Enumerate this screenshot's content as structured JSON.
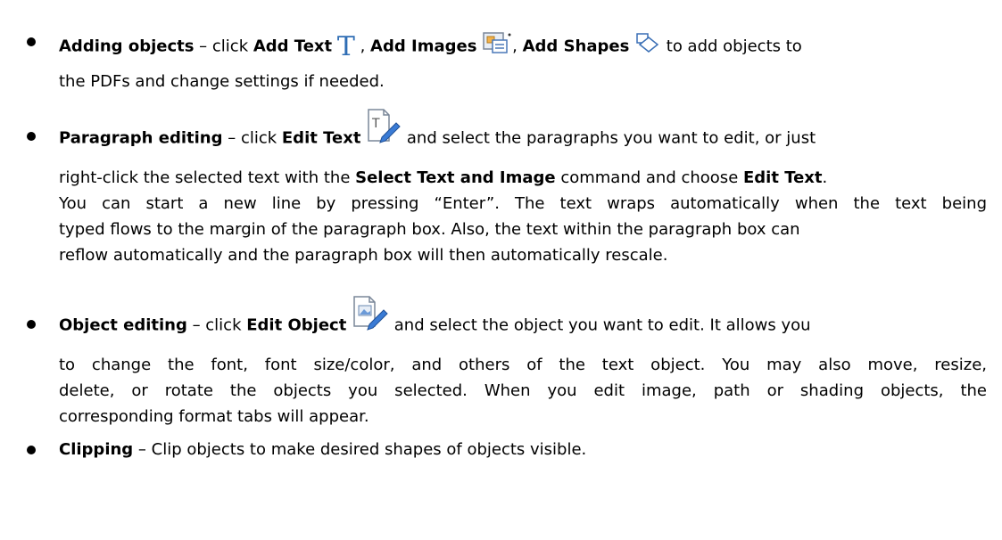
{
  "items": [
    {
      "title": "Adding objects",
      "lines": {
        "l1_dash": " – click ",
        "l1_b1": "Add Text",
        "l1_comma1": " , ",
        "l1_b2": "Add Images",
        "l1_comma2": ", ",
        "l1_b3": "Add Shapes",
        "l1_tail": " to add objects to",
        "l2": "the PDFs and change settings if needed."
      },
      "icons": [
        "text-icon",
        "add-images-icon",
        "add-shapes-icon"
      ]
    },
    {
      "title": "Paragraph editing",
      "lines": {
        "l1_dash": " – click ",
        "l1_b1": "Edit Text",
        "l1_tail": " and select the paragraphs you want to edit, or just",
        "l2_a": "right-click the selected text with the ",
        "l2_b": "Select Text and Image",
        "l2_c": " command and choose ",
        "l2_d": "Edit Text",
        "l2_e": ".",
        "l3": "You can start a new line by pressing “Enter”. The text wraps automatically when the text being",
        "l4": "typed flows to the margin of the paragraph box. Also, the text within the paragraph box can",
        "l5": "reflow automatically and the paragraph box will then automatically rescale."
      },
      "icons": [
        "edit-text-icon"
      ]
    },
    {
      "title": "Object editing",
      "lines": {
        "l1_dash": " – click ",
        "l1_b1": "Edit Object",
        "l1_tail": " and select the object you want to edit. It allows you",
        "l2": "to change the font, font size/color, and others of the text object. You may also move, resize,",
        "l3": "delete, or rotate the objects you selected. When you edit image, path or shading objects, the",
        "l4": "corresponding format tabs will appear."
      },
      "icons": [
        "edit-object-icon"
      ]
    },
    {
      "title": "Clipping",
      "lines": {
        "l1_tail": " – Clip objects to make desired shapes of objects visible."
      }
    }
  ],
  "colors": {
    "icon_blue": "#2e6db4",
    "pencil_blue": "#3a7bd5",
    "text": "#000000"
  }
}
